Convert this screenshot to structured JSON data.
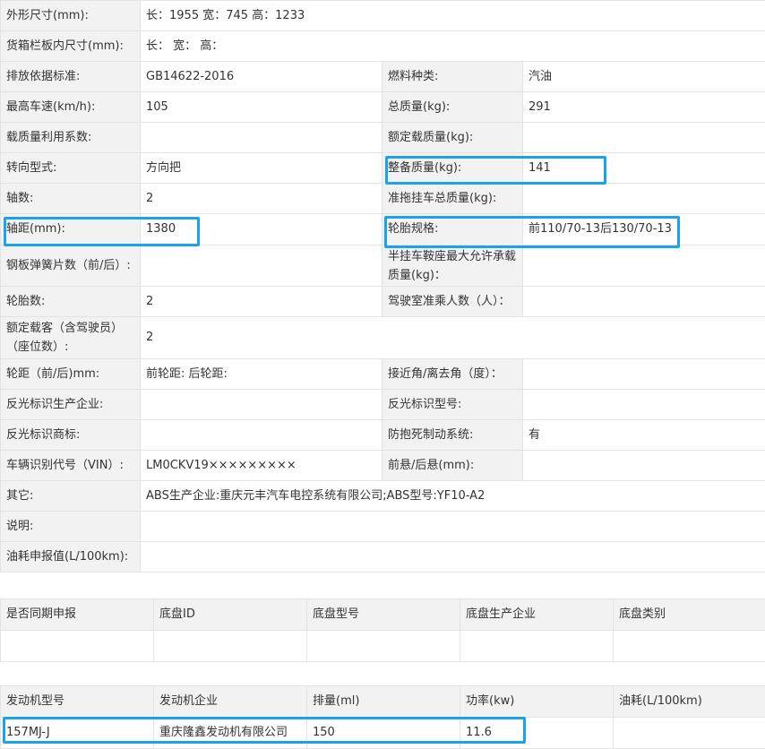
{
  "spec_rows": [
    {
      "type": "wide",
      "label": "外形尺寸(mm):",
      "value": "长：1955 宽：745 高：1233"
    },
    {
      "type": "wide",
      "label": "货箱栏板内尺寸(mm):",
      "value": "长：  宽：  高："
    },
    {
      "type": "pair",
      "l1": "排放依据标准:",
      "v1": "GB14622-2016",
      "l2": "燃料种类:",
      "v2": "汽油"
    },
    {
      "type": "pair",
      "l1": "最高车速(km/h):",
      "v1": "105",
      "l2": "总质量(kg):",
      "v2": "291"
    },
    {
      "type": "pair",
      "l1": "载质量利用系数:",
      "v1": "",
      "l2": "额定载质量(kg):",
      "v2": ""
    },
    {
      "type": "pair",
      "l1": "转向型式:",
      "v1": "方向把",
      "l2": "整备质量(kg):",
      "v2": "141"
    },
    {
      "type": "pair",
      "l1": "轴数:",
      "v1": "2",
      "l2": "准拖挂车总质量(kg):",
      "v2": ""
    },
    {
      "type": "pair",
      "l1": "轴距(mm):",
      "v1": "1380",
      "l2": "轮胎规格:",
      "v2": "前110/70-13后130/70-13"
    },
    {
      "type": "pair",
      "l1": "钢板弹簧片数（前/后）:",
      "v1": "",
      "l2": "半挂车鞍座最大允许承载质量(kg)：",
      "v2": ""
    },
    {
      "type": "pair",
      "l1": "轮胎数:",
      "v1": "2",
      "l2": "驾驶室准乘人数（人）：",
      "v2": ""
    },
    {
      "type": "wide",
      "label": "额定载客（含驾驶员）（座位数）:",
      "value": "2"
    },
    {
      "type": "pair",
      "l1": "轮距（前/后)mm:",
      "v1": "前轮距: 后轮距:",
      "l2": "接近角/离去角（度）：",
      "v2": ""
    },
    {
      "type": "pair",
      "l1": "反光标识生产企业:",
      "v1": "",
      "l2": "反光标识型号:",
      "v2": ""
    },
    {
      "type": "pair",
      "l1": "反光标识商标:",
      "v1": "",
      "l2": "防抱死制动系统:",
      "v2": "有"
    },
    {
      "type": "pair",
      "l1": "车辆识别代号（VIN）:",
      "v1": "LM0CKV19×××××××××",
      "l2": "前悬/后悬(mm):",
      "v2": ""
    },
    {
      "type": "wide",
      "label": "其它:",
      "value": "ABS生产企业:重庆元丰汽车电控系统有限公司;ABS型号:YF10-A2"
    },
    {
      "type": "wide",
      "label": "说明:",
      "value": ""
    },
    {
      "type": "wide",
      "label": "油耗申报值(L/100km):",
      "value": ""
    }
  ],
  "chassis": {
    "headers": [
      "是否同期申报",
      "底盘ID",
      "底盘型号",
      "底盘生产企业",
      "底盘类别"
    ],
    "values": [
      "",
      "",
      "",
      "",
      ""
    ]
  },
  "engine": {
    "headers": [
      "发动机型号",
      "发动机企业",
      "排量(ml)",
      "功率(kw)",
      "油耗(L/100km)"
    ],
    "values": [
      "157MJ-J",
      "重庆隆鑫发动机有限公司",
      "150",
      "11.6",
      ""
    ]
  },
  "colors": {
    "highlight": "#1aa3e8",
    "label_bg": "#f2f2f2",
    "border": "#e3e3e3",
    "text": "#333333"
  }
}
